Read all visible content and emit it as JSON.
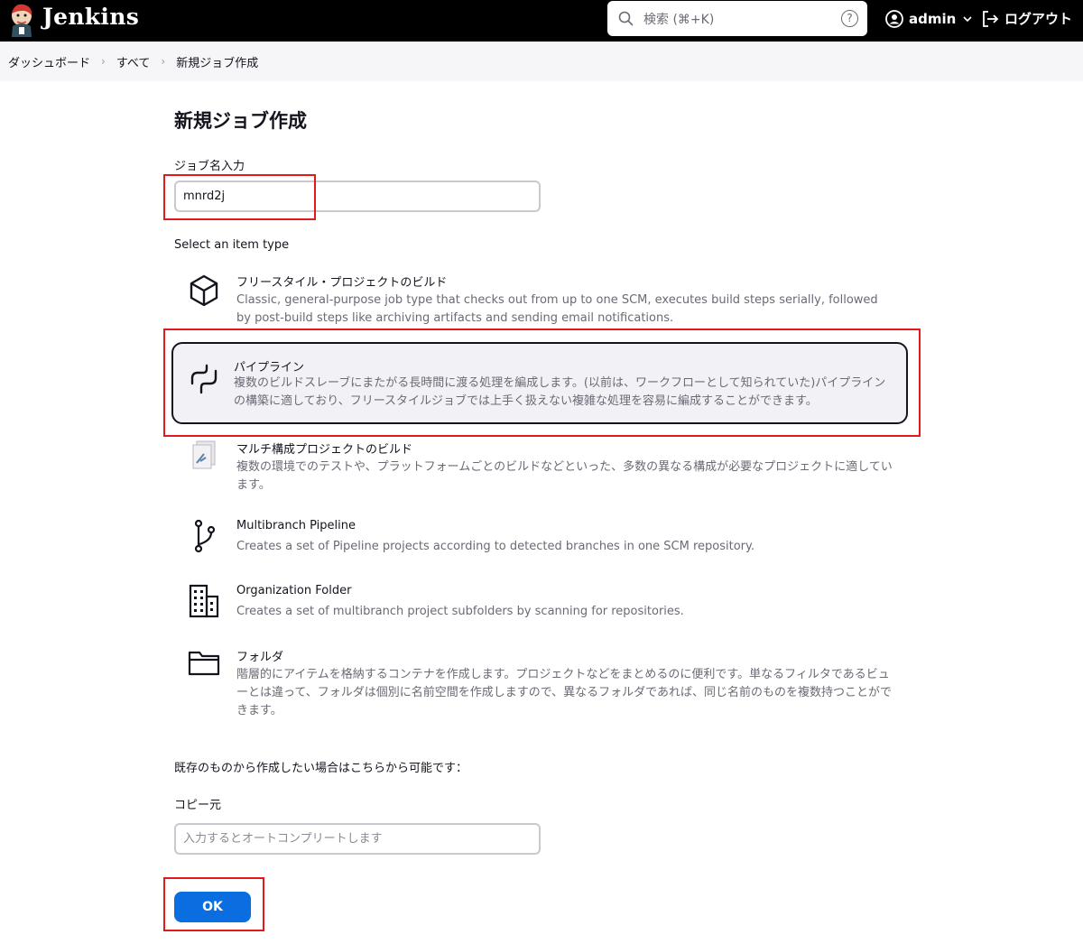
{
  "header": {
    "brand": "Jenkins",
    "search_placeholder": "検索 (⌘+K)",
    "help_icon": "?",
    "user": "admin",
    "logout": "ログアウト"
  },
  "breadcrumb": [
    "ダッシュボード",
    "すべて",
    "新規ジョブ作成"
  ],
  "page": {
    "title": "新規ジョブ作成",
    "name_label": "ジョブ名入力",
    "name_value": "mnrd2j",
    "type_label": "Select an item type"
  },
  "item_types": [
    {
      "icon": "package-icon",
      "title": "フリースタイル・プロジェクトのビルド",
      "desc": "Classic, general-purpose job type that checks out from up to one SCM, executes build steps serially, followed by post-build steps like archiving artifacts and sending email notifications."
    },
    {
      "icon": "pipeline-icon",
      "title": "パイプライン",
      "selected": true,
      "desc": "複数のビルドスレーブにまたがる長時間に渡る処理を編成します。(以前は、ワークフローとして知られていた)パイプラインの構築に適しており、フリースタイルジョブでは上手く扱えない複雑な処理を容易に編成することができます。"
    },
    {
      "icon": "multi-config-icon",
      "title": "マルチ構成プロジェクトのビルド",
      "desc": "複数の環境でのテストや、プラットフォームごとのビルドなどといった、多数の異なる構成が必要なプロジェクトに適しています。"
    },
    {
      "icon": "branch-icon",
      "title": "Multibranch Pipeline",
      "desc": "Creates a set of Pipeline projects according to detected branches in one SCM repository."
    },
    {
      "icon": "organization-icon",
      "title": "Organization Folder",
      "desc": "Creates a set of multibranch project subfolders by scanning for repositories."
    },
    {
      "icon": "folder-icon",
      "title": "フォルダ",
      "desc": "階層的にアイテムを格納するコンテナを作成します。プロジェクトなどをまとめるのに便利です。単なるフィルタであるビューとは違って、フォルダは個別に名前空間を作成しますので、異なるフォルダであれば、同じ名前のものを複数持つことができます。"
    }
  ],
  "copy": {
    "intro": "既存のものから作成したい場合はこちらから可能です：",
    "label": "コピー元",
    "placeholder": "入力するとオートコンプリートします"
  },
  "ok_label": "OK",
  "colors": {
    "header_bg": "#000000",
    "ok_button": "#0b6ee0",
    "highlight": "#e0191b"
  }
}
